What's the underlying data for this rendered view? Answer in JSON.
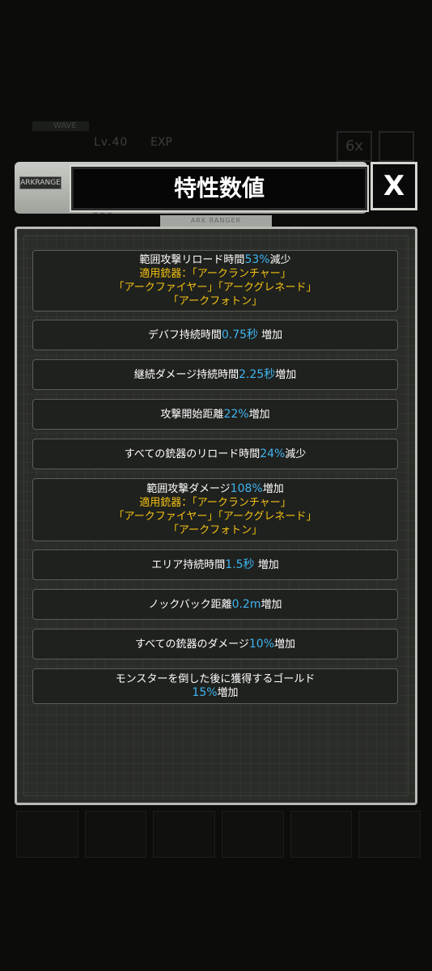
{
  "background": {
    "wave_label": "WAVE",
    "level": "Lv.40",
    "exp": "EXP",
    "speed": "6x"
  },
  "header": {
    "tag": "ARKRANGE",
    "title": "特性数値",
    "close_label": "X",
    "subplate": "ARK RANGER"
  },
  "colors": {
    "accent_value": "#3fb4f0",
    "accent_weapon": "#f5c211"
  },
  "traits": [
    {
      "lines": [
        [
          {
            "t": "範囲攻撃リロード時間",
            "c": "w"
          },
          {
            "t": "53%",
            "c": "c"
          },
          {
            "t": "減少",
            "c": "w"
          }
        ],
        [
          {
            "t": "適用銃器：「アークランチャー」",
            "c": "y"
          }
        ],
        [
          {
            "t": "「アークファイヤー」「アークグレネード」",
            "c": "y"
          }
        ],
        [
          {
            "t": "「アークフォトン」",
            "c": "y"
          }
        ]
      ]
    },
    {
      "lines": [
        [
          {
            "t": "デバフ持続時間",
            "c": "w"
          },
          {
            "t": "0.75秒",
            "c": "c"
          },
          {
            "t": " 増加",
            "c": "w"
          }
        ]
      ]
    },
    {
      "lines": [
        [
          {
            "t": "継続ダメージ持続時間",
            "c": "w"
          },
          {
            "t": "2.25秒",
            "c": "c"
          },
          {
            "t": "増加",
            "c": "w"
          }
        ]
      ]
    },
    {
      "lines": [
        [
          {
            "t": "攻撃開始距離",
            "c": "w"
          },
          {
            "t": "22%",
            "c": "c"
          },
          {
            "t": "増加",
            "c": "w"
          }
        ]
      ]
    },
    {
      "lines": [
        [
          {
            "t": "すべての銃器のリロード時間",
            "c": "w"
          },
          {
            "t": "24%",
            "c": "c"
          },
          {
            "t": "減少",
            "c": "w"
          }
        ]
      ]
    },
    {
      "lines": [
        [
          {
            "t": "範囲攻撃ダメージ",
            "c": "w"
          },
          {
            "t": "108%",
            "c": "c"
          },
          {
            "t": "増加",
            "c": "w"
          }
        ],
        [
          {
            "t": "適用銃器：「アークランチャー」",
            "c": "y"
          }
        ],
        [
          {
            "t": "「アークファイヤー」「アークグレネード」",
            "c": "y"
          }
        ],
        [
          {
            "t": "「アークフォトン」",
            "c": "y"
          }
        ]
      ]
    },
    {
      "lines": [
        [
          {
            "t": "エリア持続時間",
            "c": "w"
          },
          {
            "t": "1.5秒",
            "c": "c"
          },
          {
            "t": " 増加",
            "c": "w"
          }
        ]
      ]
    },
    {
      "lines": [
        [
          {
            "t": "ノックバック距離",
            "c": "w"
          },
          {
            "t": "0.2m",
            "c": "c"
          },
          {
            "t": "増加",
            "c": "w"
          }
        ]
      ]
    },
    {
      "lines": [
        [
          {
            "t": "すべての銃器のダメージ",
            "c": "w"
          },
          {
            "t": "10%",
            "c": "c"
          },
          {
            "t": "増加",
            "c": "w"
          }
        ]
      ]
    },
    {
      "lines": [
        [
          {
            "t": "モンスターを倒した後に獲得するゴールド",
            "c": "w"
          }
        ],
        [
          {
            "t": "15%",
            "c": "c"
          },
          {
            "t": "増加",
            "c": "w"
          }
        ]
      ]
    }
  ]
}
